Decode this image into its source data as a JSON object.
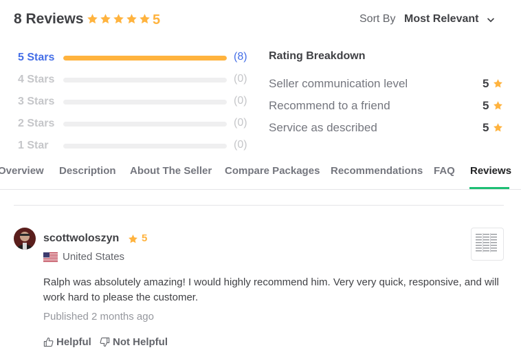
{
  "header": {
    "title": "8 Reviews",
    "score": "5",
    "rating_stars": 5,
    "sort_label": "Sort By",
    "sort_value": "Most Relevant"
  },
  "star_breakdown": [
    {
      "label": "5 Stars",
      "count": "(8)",
      "fraction": 1.0
    },
    {
      "label": "4 Stars",
      "count": "(0)",
      "fraction": 0
    },
    {
      "label": "3 Stars",
      "count": "(0)",
      "fraction": 0
    },
    {
      "label": "2 Stars",
      "count": "(0)",
      "fraction": 0
    },
    {
      "label": "1 Star",
      "count": "(0)",
      "fraction": 0
    }
  ],
  "rating_breakdown": {
    "title": "Rating Breakdown",
    "items": [
      {
        "label": "Seller communication level",
        "value": "5"
      },
      {
        "label": "Recommend to a friend",
        "value": "5"
      },
      {
        "label": "Service as described",
        "value": "5"
      }
    ]
  },
  "tabs": [
    {
      "label": "Overview"
    },
    {
      "label": "Description"
    },
    {
      "label": "About The Seller"
    },
    {
      "label": "Compare Packages"
    },
    {
      "label": "Recommendations"
    },
    {
      "label": "FAQ"
    },
    {
      "label": "Reviews"
    }
  ],
  "active_tab": "Reviews",
  "review": {
    "username": "scottwoloszyn",
    "score": "5",
    "country": "United States",
    "text": "Ralph was absolutely amazing! I would highly recommend him. Very very quick, responsive, and will work hard to please the customer.",
    "published": "Published 2 months ago",
    "helpful_label": "Helpful",
    "not_helpful_label": "Not Helpful"
  },
  "colors": {
    "star": "#ffb33e",
    "accent_blue": "#446ee7",
    "tab_underline": "#1dbf73",
    "text_dark": "#404145",
    "text_muted": "#74767e"
  },
  "icons": {
    "star": "star-icon",
    "chevron": "chevron-down-icon",
    "thumbs_up": "thumbs-up-icon",
    "thumbs_down": "thumbs-down-icon",
    "flag": "us-flag-icon"
  }
}
